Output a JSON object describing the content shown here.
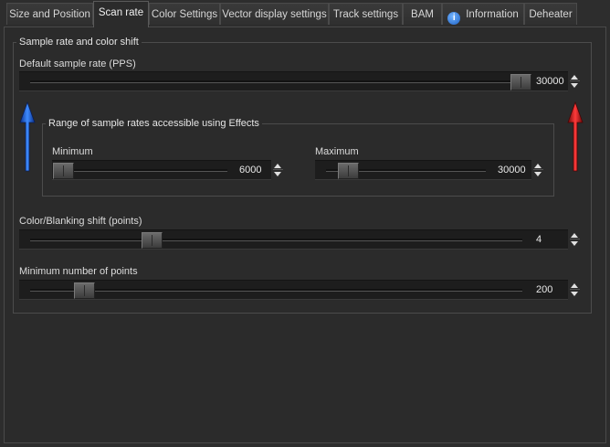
{
  "tabs": [
    {
      "label": "Size and Position"
    },
    {
      "label": "Scan rate"
    },
    {
      "label": "Color Settings"
    },
    {
      "label": "Vector display settings"
    },
    {
      "label": "Track settings"
    },
    {
      "label": "BAM"
    },
    {
      "label": "Information"
    },
    {
      "label": "Deheater"
    }
  ],
  "active_tab": "Scan rate",
  "group_main": {
    "title": "Sample rate and color shift",
    "default_rate": {
      "label": "Default sample rate (PPS)",
      "value": "30000",
      "fraction": 0.98
    },
    "effects_group": {
      "title": "Range of sample rates accessible using Effects",
      "minimum": {
        "label": "Minimum",
        "value": "6000",
        "fraction": 0.0
      },
      "maximum": {
        "label": "Maximum",
        "value": "30000",
        "fraction": 0.12
      }
    },
    "color_shift": {
      "label": "Color/Blanking shift (points)",
      "value": "4",
      "fraction": 0.24
    },
    "min_points": {
      "label": "Minimum number of points",
      "value": "200",
      "fraction": 0.11
    }
  },
  "colors": {
    "up_arrow": "#1e5fd6",
    "down_arrow": "#c41414"
  },
  "icons": {
    "info": "info-icon",
    "spin_up": "spin-up-icon",
    "spin_down": "spin-down-icon"
  }
}
